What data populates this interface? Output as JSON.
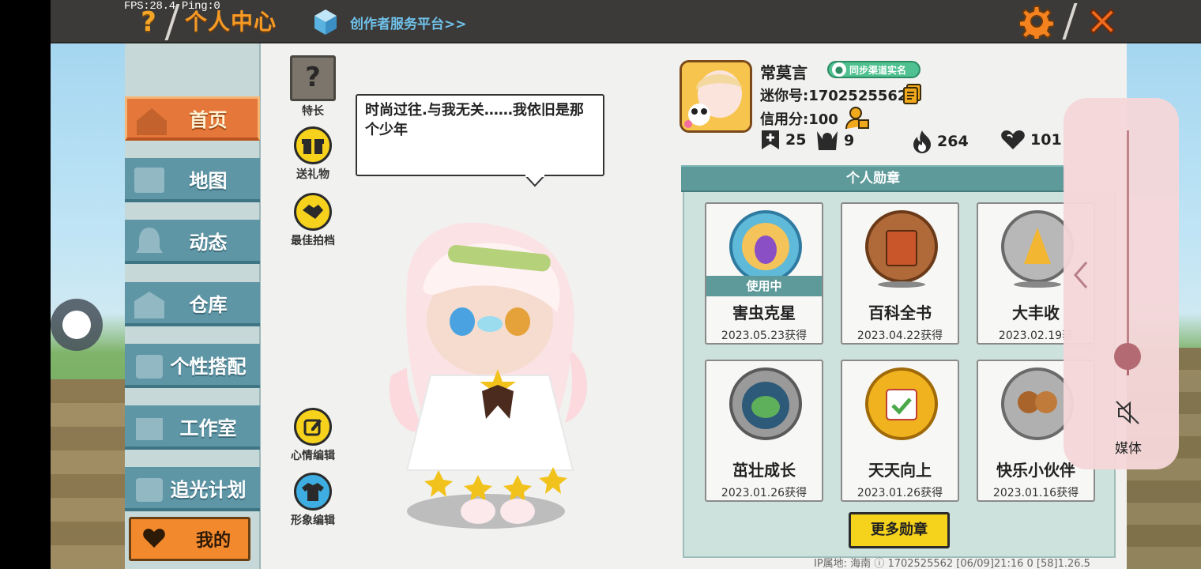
{
  "status": {
    "fps": "FPS:28.4",
    "ping": "Ping:0"
  },
  "header": {
    "help_symbol": "?",
    "title": "个人中心",
    "creator_link": "创作者服务平台>>"
  },
  "sidebar": {
    "items": [
      {
        "label": "首页",
        "icon": "house-icon",
        "active": true
      },
      {
        "label": "地图",
        "icon": "map-icon",
        "active": false
      },
      {
        "label": "动态",
        "icon": "bell-icon",
        "active": false
      },
      {
        "label": "仓库",
        "icon": "warehouse-icon",
        "active": false
      },
      {
        "label": "个性搭配",
        "icon": "outfit-icon",
        "active": false
      },
      {
        "label": "工作室",
        "icon": "studio-icon",
        "active": false
      },
      {
        "label": "追光计划",
        "icon": "plan-icon",
        "active": false
      }
    ],
    "mine_label": "我的"
  },
  "actions": {
    "talent": "特长",
    "gift": "送礼物",
    "best_partner": "最佳拍档",
    "mood_edit": "心情编辑",
    "image_edit": "形象编辑"
  },
  "bubble": {
    "text": "时尚过往.与我无关……我依旧是那个少年"
  },
  "profile": {
    "name": "常莫言",
    "sync_badge": "同步渠道实名",
    "mini_id": "迷你号:1702525562",
    "credit": "信用分:100",
    "stats": {
      "collects": "25",
      "fans": "9",
      "heat": "264",
      "likes": "101"
    }
  },
  "medals": {
    "header": "个人勋章",
    "in_use_label": "使用中",
    "items": [
      {
        "name": "害虫克星",
        "date": "2023.05.23获得",
        "in_use": true,
        "color": "#5fb9d8"
      },
      {
        "name": "百科全书",
        "date": "2023.04.22获得",
        "in_use": false,
        "color": "#b06a3a"
      },
      {
        "name": "大丰收",
        "date": "2023.02.19获",
        "in_use": false,
        "color": "#a8a8a8"
      },
      {
        "name": "茁壮成长",
        "date": "2023.01.26获得",
        "in_use": false,
        "color": "#9a9a9a"
      },
      {
        "name": "天天向上",
        "date": "2023.01.26获得",
        "in_use": false,
        "color": "#f0b21e"
      },
      {
        "name": "快乐小伙伴",
        "date": "2023.01.16获得",
        "in_use": false,
        "color": "#a8a8a8"
      }
    ],
    "more_button": "更多勋章"
  },
  "footer": {
    "text": "IP属地: 海南 ⓘ    1702525562   [06/09]21:16 0  [58]1.26.5"
  },
  "volume": {
    "label": "媒体",
    "level": 0.1,
    "muted": true
  },
  "colors": {
    "accent_orange": "#f79a25",
    "nav_teal": "#5f96a6",
    "medal_teal": "#5f9a9a",
    "button_yellow": "#f5d21b"
  }
}
